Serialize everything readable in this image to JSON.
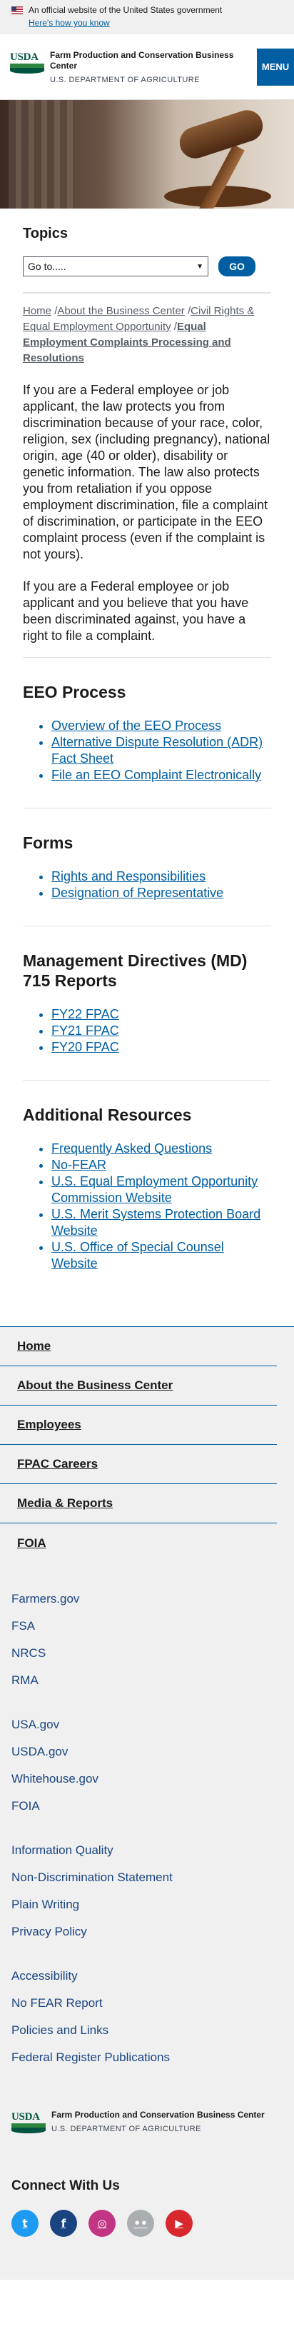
{
  "gov_banner": {
    "text": "An official website of the United States government",
    "link": "Here's how you know"
  },
  "header": {
    "logo_text": "USDA",
    "agency": "Farm Production and Conservation Business Center",
    "department": "U.S. DEPARTMENT OF AGRICULTURE",
    "menu_label": "MENU"
  },
  "topics": {
    "heading": "Topics",
    "select_value": "Go to.....",
    "go_label": "GO"
  },
  "breadcrumb": {
    "items": [
      "Home",
      "About the Business Center",
      "Civil Rights & Equal Employment Opportunity"
    ],
    "current": "Equal Employment Complaints Processing and Resolutions",
    "separator": "/"
  },
  "content": {
    "paragraph1": "If you are a Federal employee or job applicant, the law protects you from discrimination because of your race, color, religion, sex (including pregnancy), national origin, age (40 or older), disability or genetic information. The law also protects you from retaliation if you oppose employment discrimination, file a complaint of discrimination, or participate in the EEO complaint process (even if the complaint is not yours).",
    "paragraph2": "If you are a Federal employee or job applicant and you believe that you have been discriminated against, you have a right to file a complaint."
  },
  "sections": {
    "eeo": {
      "heading": "EEO Process",
      "links": [
        "Overview of the EEO Process",
        "Alternative Dispute Resolution (ADR) Fact Sheet",
        "File an EEO Complaint Electronically"
      ]
    },
    "forms": {
      "heading": "Forms",
      "links": [
        "Rights and Responsibilities",
        "Designation of Representative"
      ]
    },
    "md715": {
      "heading": "Management Directives (MD) 715 Reports",
      "links": [
        "FY22 FPAC",
        "FY21 FPAC",
        "FY20 FPAC"
      ]
    },
    "resources": {
      "heading": "Additional Resources",
      "links": [
        "Frequently Asked Questions",
        "No-FEAR",
        "U.S. Equal Employment Opportunity Commission Website",
        "U.S. Merit Systems Protection Board Website",
        "U.S. Office of Special Counsel Website"
      ]
    }
  },
  "bottom_nav": [
    "Home",
    "About the Business Center",
    "Employees",
    "FPAC Careers",
    "Media & Reports",
    "FOIA"
  ],
  "footer": {
    "group1": [
      "Farmers.gov",
      "FSA",
      "NRCS",
      "RMA"
    ],
    "group2": [
      "USA.gov",
      "USDA.gov",
      "Whitehouse.gov",
      "FOIA"
    ],
    "group3": [
      "Information Quality",
      "Non-Discrimination Statement",
      "Plain Writing",
      "Privacy Policy"
    ],
    "group4": [
      "Accessibility",
      "No FEAR Report",
      "Policies and Links",
      "Federal Register Publications"
    ],
    "agency": "Farm Production and Conservation Business Center",
    "department": "U.S. DEPARTMENT OF AGRICULTURE",
    "connect_heading": "Connect With Us",
    "social": [
      {
        "name": "twitter-icon",
        "glyph": "t",
        "color": "#1d9bf0"
      },
      {
        "name": "facebook-icon",
        "glyph": "f",
        "color": "#1a4480"
      },
      {
        "name": "instagram-icon",
        "glyph": "◎",
        "color": "#c13584"
      },
      {
        "name": "flickr-icon",
        "glyph": "••",
        "color": "#a9aeb1"
      },
      {
        "name": "youtube-icon",
        "glyph": "▶",
        "color": "#d8282d"
      }
    ]
  }
}
